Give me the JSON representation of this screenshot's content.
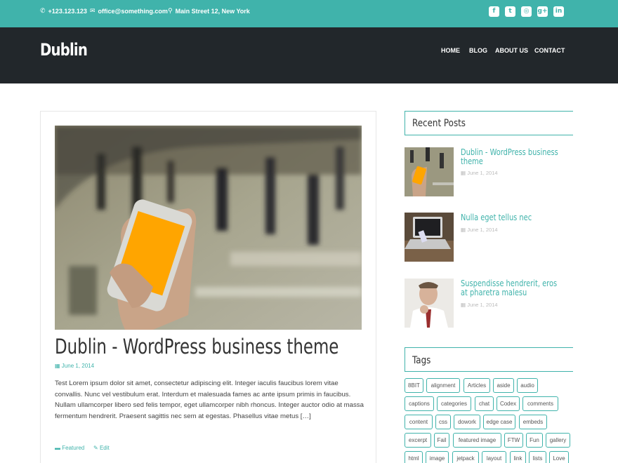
{
  "topbar": {
    "phone": "+123.123.123",
    "email": "office@something.com",
    "address": "Main Street 12, New York",
    "social": [
      {
        "icon": "facebook-icon",
        "glyph": "f"
      },
      {
        "icon": "twitter-icon",
        "glyph": "t"
      },
      {
        "icon": "instagram-icon",
        "glyph": "◎"
      },
      {
        "icon": "google-plus-icon",
        "glyph": "g+"
      },
      {
        "icon": "linkedin-icon",
        "glyph": "in"
      }
    ]
  },
  "header": {
    "site_title": "Dublin",
    "nav": [
      "HOME",
      "BLOG",
      "ABOUT US",
      "CONTACT"
    ]
  },
  "post": {
    "title": "Dublin - WordPress business theme",
    "date": "June 1, 2014",
    "excerpt": "Test Lorem ipsum dolor sit amet, consectetur adipiscing elit. Integer iaculis faucibus lorem vitae convallis. Nunc vel vestibulum erat. Interdum et malesuada fames ac ante ipsum primis in faucibus. Nullam ullamcorper libero sed felis tempor, eget ullamcorper nibh rhoncus. Integer auctor odio at massa fermentum hendrerit. Praesent sagittis nec sem at egestas. Phasellus vitae metus […]",
    "category": "Featured",
    "edit": "Edit"
  },
  "sidebar": {
    "recent_title": "Recent Posts",
    "recent": [
      {
        "title": "Dublin - WordPress business theme",
        "date": "June 1, 2014"
      },
      {
        "title": "Nulla eget tellus nec",
        "date": "June 1, 2014"
      },
      {
        "title": "Suspendisse hendrerit, eros at pharetra malesu",
        "date": "June 1, 2014"
      }
    ],
    "tags_title": "Tags",
    "tags": [
      "8BIT",
      "alignment",
      "Articles",
      "aside",
      "audio",
      "captions",
      "categories",
      "chat",
      "Codex",
      "comments",
      "content",
      "css",
      "dowork",
      "edge case",
      "embeds",
      "excerpt",
      "Fail",
      "featured image",
      "FTW",
      "Fun",
      "gallery",
      "html",
      "image",
      "jetpack",
      "layout",
      "link",
      "lists",
      "Love"
    ]
  },
  "colors": {
    "accent": "#40b3ab",
    "header_bg": "#22272b",
    "phone_screen": "#ffa500"
  }
}
